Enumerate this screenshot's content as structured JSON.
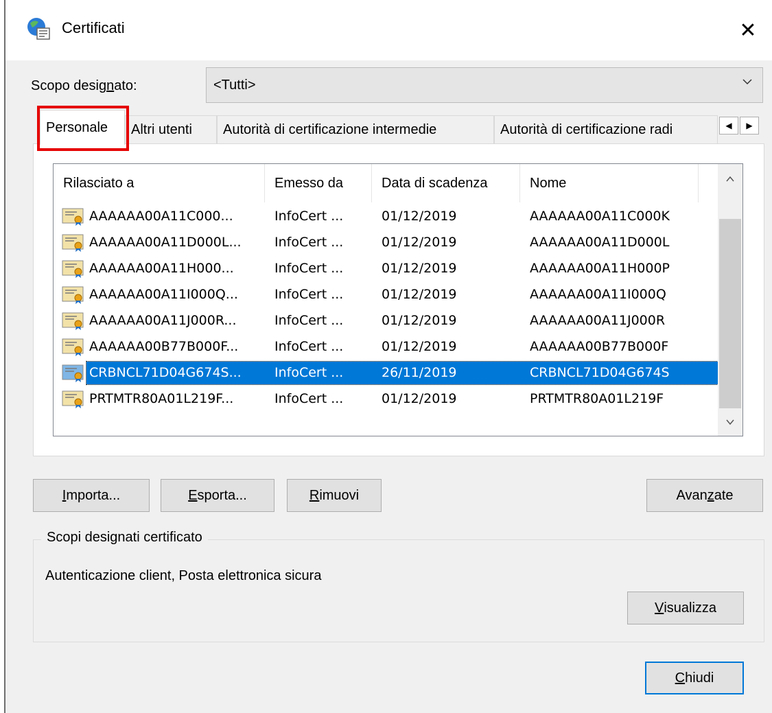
{
  "window": {
    "title": "Certificati",
    "close_label": "✕"
  },
  "scope": {
    "label": "Scopo designato:",
    "value": "<Tutti>"
  },
  "tabs": [
    {
      "label": "Personale",
      "active": true
    },
    {
      "label": "Altri utenti",
      "active": false
    },
    {
      "label": "Autorità di certificazione intermedie",
      "active": false
    },
    {
      "label": "Autorità di certificazione radi",
      "active": false
    }
  ],
  "list": {
    "columns": [
      "Rilasciato a",
      "Emesso da",
      "Data di scadenza",
      "Nome"
    ],
    "rows": [
      {
        "issued_to": "AAAAAA00A11C000...",
        "issued_by": "InfoCert ...",
        "expiry": "01/12/2019",
        "name": "AAAAAA00A11C000K",
        "selected": false
      },
      {
        "issued_to": "AAAAAA00A11D000L...",
        "issued_by": "InfoCert ...",
        "expiry": "01/12/2019",
        "name": "AAAAAA00A11D000L",
        "selected": false
      },
      {
        "issued_to": "AAAAAA00A11H000...",
        "issued_by": "InfoCert ...",
        "expiry": "01/12/2019",
        "name": "AAAAAA00A11H000P",
        "selected": false
      },
      {
        "issued_to": "AAAAAA00A11I000Q...",
        "issued_by": "InfoCert ...",
        "expiry": "01/12/2019",
        "name": "AAAAAA00A11I000Q",
        "selected": false
      },
      {
        "issued_to": "AAAAAA00A11J000R...",
        "issued_by": "InfoCert ...",
        "expiry": "01/12/2019",
        "name": "AAAAAA00A11J000R",
        "selected": false
      },
      {
        "issued_to": "AAAAAA00B77B000F...",
        "issued_by": "InfoCert ...",
        "expiry": "01/12/2019",
        "name": "AAAAAA00B77B000F",
        "selected": false
      },
      {
        "issued_to": "CRBNCL71D04G674S...",
        "issued_by": "InfoCert ...",
        "expiry": "26/11/2019",
        "name": "CRBNCL71D04G674S",
        "selected": true
      },
      {
        "issued_to": "PRTMTR80A01L219F...",
        "issued_by": "InfoCert ...",
        "expiry": "01/12/2019",
        "name": "PRTMTR80A01L219F",
        "selected": false
      }
    ]
  },
  "buttons": {
    "import": {
      "pre": "",
      "key": "I",
      "post": "mporta..."
    },
    "export": {
      "pre": "",
      "key": "E",
      "post": "sporta..."
    },
    "remove": {
      "pre": "",
      "key": "R",
      "post": "imuovi"
    },
    "advanced": {
      "pre": "Avan",
      "key": "z",
      "post": "ate"
    },
    "view": {
      "pre": "",
      "key": "V",
      "post": "isualizza"
    },
    "close": {
      "pre": "",
      "key": "C",
      "post": "hiudi"
    }
  },
  "purposes_group": {
    "title": "Scopi designati certificato",
    "text": "Autenticazione client, Posta elettronica sicura"
  },
  "colors": {
    "selection": "#0078d7",
    "highlight_box": "#e60000"
  }
}
